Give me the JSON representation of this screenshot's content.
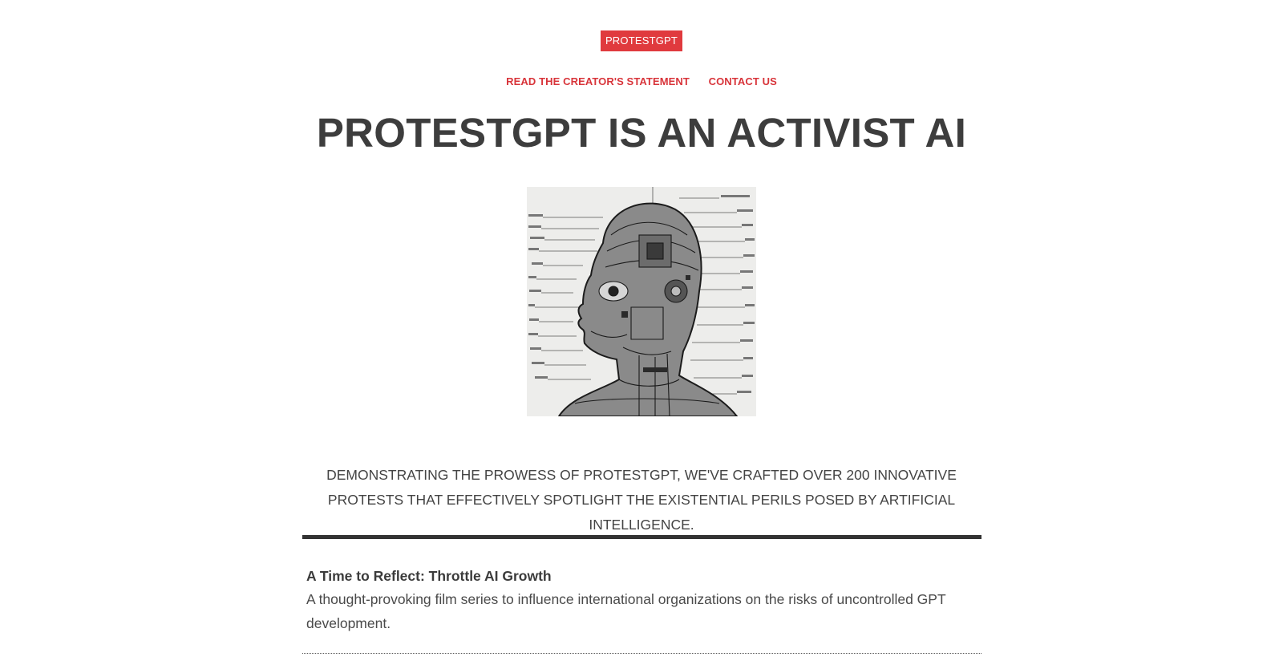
{
  "header": {
    "site_name": "PROTESTGPT",
    "nav": [
      {
        "label": "READ THE CREATOR'S STATEMENT"
      },
      {
        "label": "CONTACT US"
      }
    ]
  },
  "main": {
    "title": "PROTESTGPT IS AN ACTIVIST AI",
    "tagline": "DEMONSTRATING THE PROWESS OF PROTESTGPT, WE'VE CRAFTED OVER 200 INNOVATIVE PROTESTS THAT EFFECTIVELY SPOTLIGHT THE EXISTENTIAL PERILS POSED BY ARTIFICIAL INTELLIGENCE.",
    "items": [
      {
        "title": "A Time to Reflect: Throttle AI Growth",
        "description": "A thought-provoking film series to influence international organizations on the risks of uncontrolled GPT development."
      }
    ]
  },
  "colors": {
    "accent": "#e03a3e",
    "text": "#3d3d3d"
  }
}
